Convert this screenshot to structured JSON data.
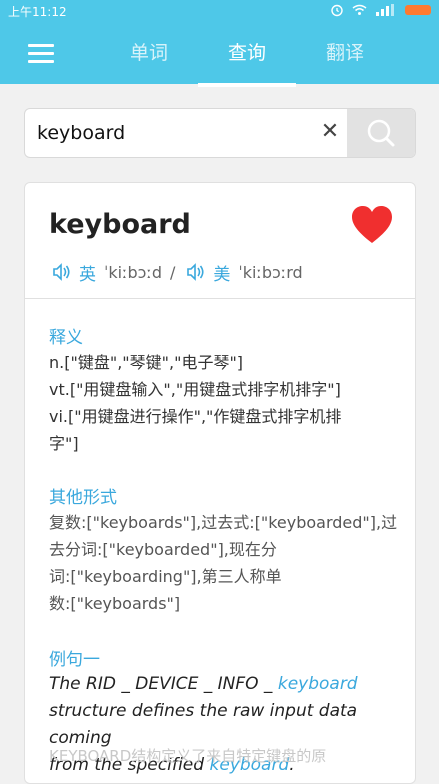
{
  "status_bar": {
    "time": "上午11:12"
  },
  "tabs": [
    {
      "label": "单词",
      "active": false
    },
    {
      "label": "查询",
      "active": true
    },
    {
      "label": "翻译",
      "active": false
    }
  ],
  "search": {
    "value": "keyboard",
    "clear_symbol": "✕"
  },
  "entry": {
    "word": "keyboard",
    "favorited": true,
    "pron_uk_label": "英",
    "pron_uk_ipa": "ˈkiːbɔːd",
    "pron_separator": "/",
    "pron_us_label": "美",
    "pron_us_ipa": "ˈkiːbɔːrd"
  },
  "definitions": {
    "title": "释义",
    "lines": [
      "n.[\"键盘\",\"琴键\",\"电子琴\"]",
      "vt.[\"用键盘输入\",\"用键盘式排字机排字\"]",
      "vi.[\"用键盘进行操作\",\"作键盘式排字机排",
      "字\"]"
    ]
  },
  "other_forms": {
    "title": "其他形式",
    "lines": [
      "复数:[\"keyboards\"],过去式:[\"keyboarded\"],过",
      "去分词:[\"keyboarded\"],现在分",
      "词:[\"keyboarding\"],第三人称单",
      "数:[\"keyboards\"]"
    ]
  },
  "example": {
    "title": "例句一",
    "line1_text": "The RID _ DEVICE _ INFO _ ",
    "line1_highlight": "keyboard",
    "line2_text": "structure defines the raw input data coming",
    "line3_text": "from the specified ",
    "line3_highlight": "keyboard",
    "line3_end": ".",
    "faded_line": "KEYBOARD结构定义了来自特定键盘的原"
  },
  "colors": {
    "header": "#4ec8e8",
    "accent": "#3aa8dd",
    "heart": "#f02f2f",
    "battery": "#ff7a30"
  },
  "icons": {
    "menu": "menu-icon",
    "search": "search-icon",
    "clear": "close-icon",
    "favorite": "heart-icon",
    "speaker": "speaker-icon"
  }
}
